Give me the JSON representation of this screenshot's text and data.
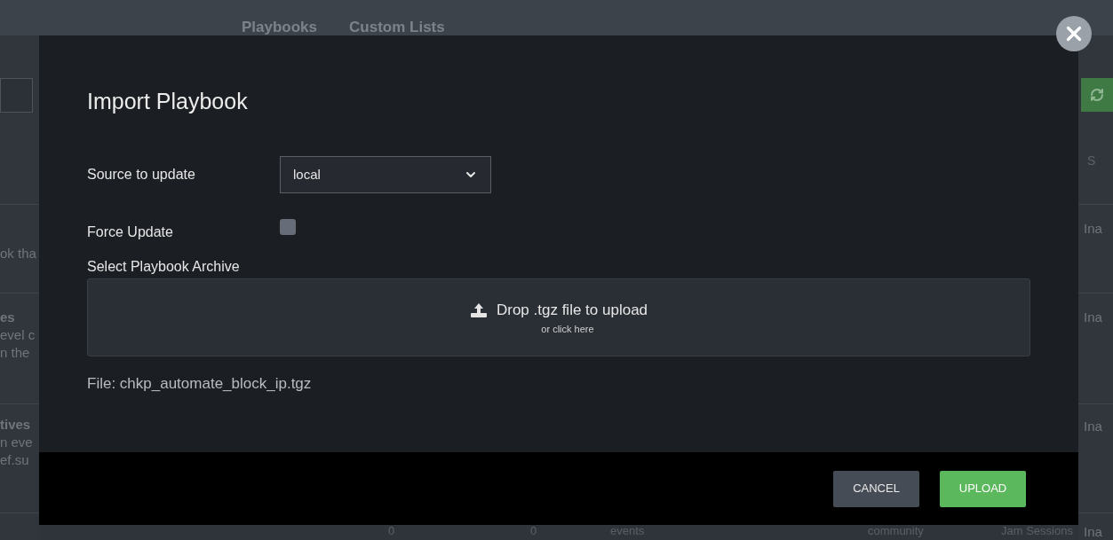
{
  "nav_tabs": [
    {
      "label": "Playbooks"
    },
    {
      "label": "Custom Lists"
    }
  ],
  "background_left": [
    {
      "lines": [
        "ok tha"
      ]
    },
    {
      "lines": [
        "es",
        "evel c",
        "n the"
      ]
    },
    {
      "lines": [
        "tives",
        "n eve",
        "ef.su"
      ]
    }
  ],
  "background_right": {
    "column_heading": "S",
    "cells": [
      "Ina",
      "Ina",
      "Ina",
      "Ina"
    ]
  },
  "background_bottom_row": [
    "0",
    "0",
    "events",
    "community",
    "Jam Sessions"
  ],
  "dialog": {
    "title": "Import Playbook",
    "fields": [
      {
        "kind": "select",
        "label": "Source to update",
        "value": "local"
      },
      {
        "kind": "checkbox",
        "label": "Force Update",
        "checked": false
      }
    ],
    "archive": {
      "label": "Select Playbook Archive",
      "drop_text": "Drop .tgz file to upload",
      "drop_hint": "or click here"
    },
    "file_text": "File: chkp_automate_block_ip.tgz",
    "buttons": [
      {
        "label": "CANCEL",
        "kind": "secondary"
      },
      {
        "label": "UPLOAD",
        "kind": "primary"
      }
    ]
  }
}
